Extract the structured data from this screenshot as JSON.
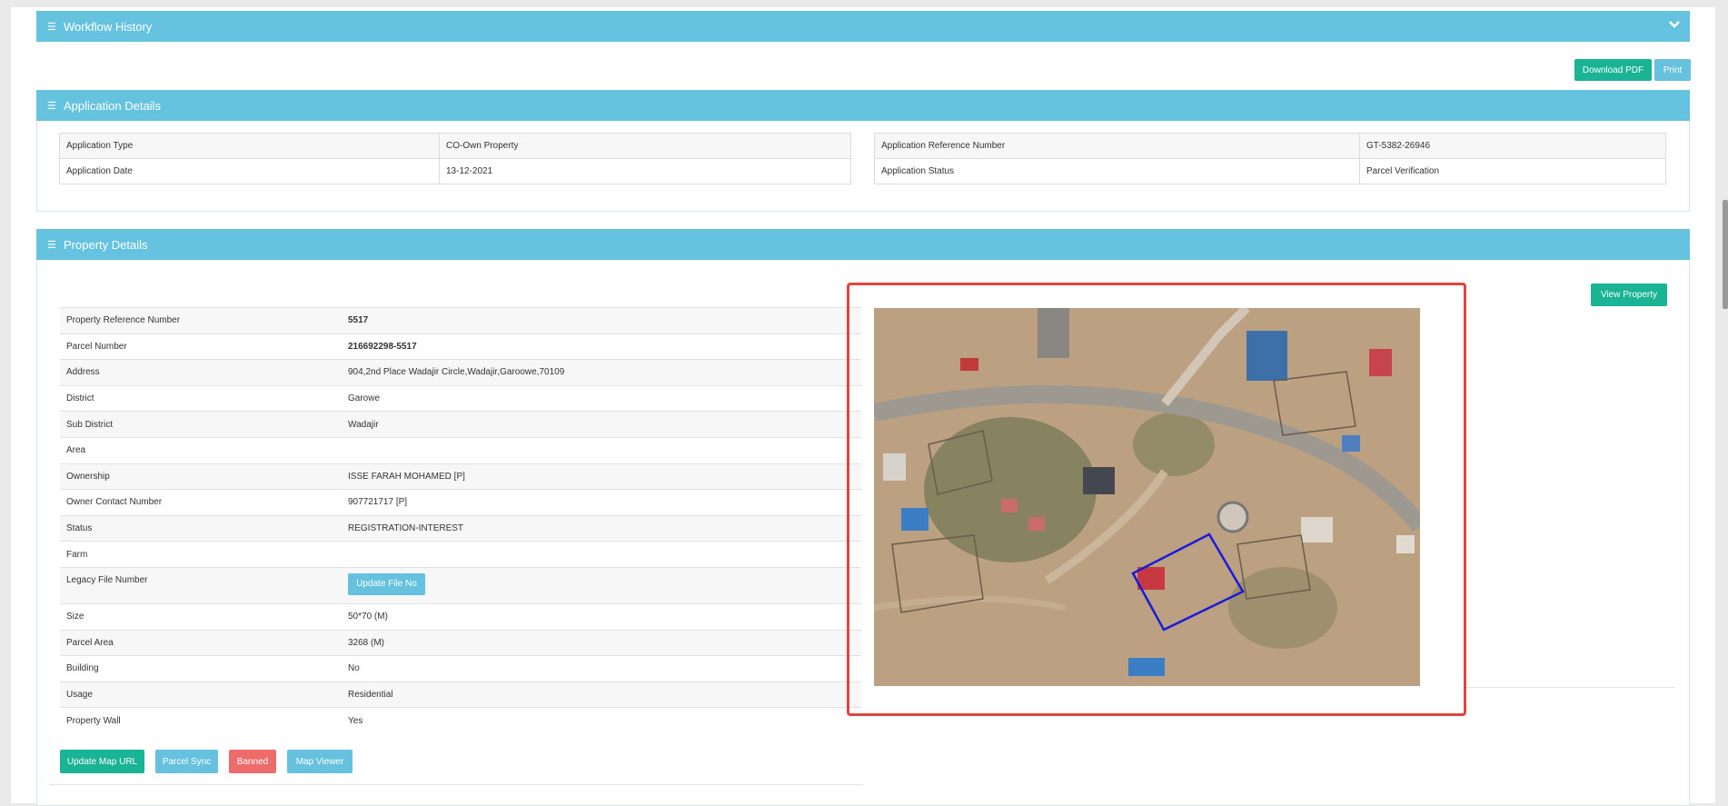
{
  "workflow": {
    "title": "Workflow History"
  },
  "toolbar": {
    "download_pdf": "Download PDF",
    "print": "Print"
  },
  "application": {
    "title": "Application Details",
    "left_rows": [
      {
        "label": "Application Type",
        "value": "CO-Own Property"
      },
      {
        "label": "Application Date",
        "value": "13-12-2021"
      }
    ],
    "right_rows": [
      {
        "label": "Application Reference Number",
        "value": "GT-5382-26946"
      },
      {
        "label": "Application Status",
        "value": "Parcel Verification"
      }
    ]
  },
  "property": {
    "title": "Property Details",
    "view_property": "View Property",
    "rows": [
      {
        "label": "Property Reference Number",
        "value": "5517"
      },
      {
        "label": "Parcel Number",
        "value": "216692298-5517"
      },
      {
        "label": "Address",
        "value": "904,2nd Place Wadajir Circle,Wadajir,Garoowe,70109"
      },
      {
        "label": "District",
        "value": "Garowe"
      },
      {
        "label": "Sub District",
        "value": "Wadajir"
      },
      {
        "label": "Area",
        "value": ""
      },
      {
        "label": "Ownership",
        "value": "ISSE FARAH MOHAMED [P]"
      },
      {
        "label": "Owner Contact Number",
        "value": "907721717 [P]"
      },
      {
        "label": "Status",
        "value": "REGISTRATION-INTEREST"
      },
      {
        "label": "Farm",
        "value": ""
      },
      {
        "label": "Legacy File Number",
        "value": ""
      },
      {
        "label": "Size",
        "value": "50*70 (M)"
      },
      {
        "label": "Parcel Area",
        "value": "3268 (M)"
      },
      {
        "label": "Building",
        "value": "No"
      },
      {
        "label": "Usage",
        "value": "Residential"
      },
      {
        "label": "Property Wall",
        "value": "Yes"
      }
    ],
    "update_file_no": "Update File No",
    "actions": {
      "update_map_url": "Update Map URL",
      "parcel_sync": "Parcel Sync",
      "banned": "Banned",
      "map_viewer": "Map Viewer"
    }
  },
  "colors": {
    "header": "#66c3e0",
    "green": "#1ab394",
    "red_button": "#ed6b6b",
    "highlight_frame": "#e0443e",
    "parcel_outline": "#1a1adc"
  },
  "icons": {
    "panel": "list-icon",
    "collapse": "chevron-down-icon"
  }
}
